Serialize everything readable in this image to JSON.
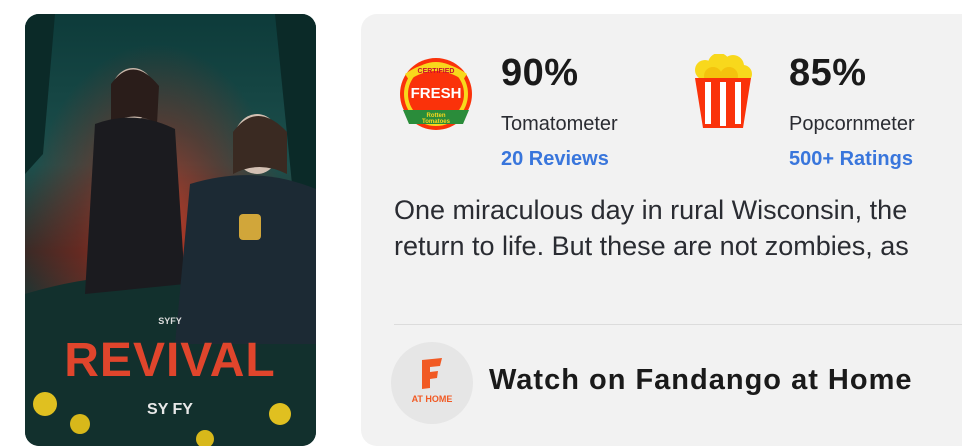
{
  "poster": {
    "title_text": "REVIVAL",
    "network_small": "SYFY",
    "network_logo": "SY FY"
  },
  "tomatometer": {
    "badge_icon": "certified-fresh-icon",
    "badge_text": [
      "CERTIFIED",
      "FRESH",
      "Rotten",
      "Tomatoes"
    ],
    "score": "90%",
    "label": "Tomatometer",
    "link": "20 Reviews",
    "color": "#fa320a"
  },
  "popcornmeter": {
    "icon": "popcorn-bucket-icon",
    "score": "85%",
    "label": "Popcornmeter",
    "link": "500+ Ratings"
  },
  "synopsis": {
    "line1": "One miraculous day in rural Wisconsin, the",
    "line2": "return to life. But these are not zombies, as"
  },
  "watch": {
    "icon": "fandango-at-home-icon",
    "icon_caption": "AT HOME",
    "label": "Watch on Fandango at Home"
  },
  "colors": {
    "link": "#3976dc",
    "card_bg": "#f2f2f2",
    "fandango": "#f15a24"
  }
}
